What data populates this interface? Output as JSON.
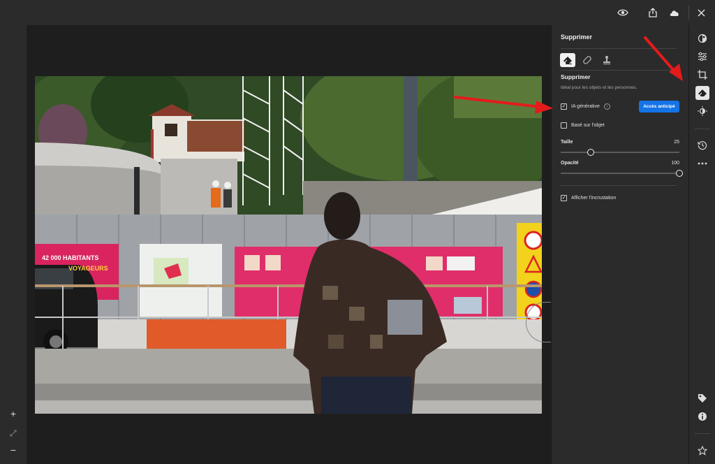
{
  "topbar": {
    "icons": [
      "eye-icon",
      "share-icon",
      "cloud-icon",
      "close-icon"
    ]
  },
  "left_toolbar": {
    "zoom_in_glyph": "+",
    "zoom_out_glyph": "−"
  },
  "panel": {
    "title": "Supprimer",
    "tools": [
      "eraser-icon",
      "bandage-icon",
      "stamp-icon"
    ],
    "section_title": "Supprimer",
    "section_desc": "Idéal pour les objets et les personnes.",
    "generative_ai": {
      "label": "IA générative",
      "checked": true
    },
    "early_access_label": "Accès anticipé",
    "object_based": {
      "label": "Basé sur l'objet",
      "checked": false
    },
    "size": {
      "label": "Taille",
      "value": "25",
      "fraction": 0.25
    },
    "opacity": {
      "label": "Opacité",
      "value": "100",
      "fraction": 1.0
    },
    "show_overlay": {
      "label": "Afficher l'incrustation",
      "checked": true
    }
  },
  "right_toolbar": {
    "icons": [
      "color-mix-icon",
      "sliders-icon",
      "crop-icon",
      "eraser-icon",
      "sun-icon",
      "history-icon",
      "more-icon",
      "tag-icon",
      "info-icon",
      "star-icon"
    ],
    "active": "eraser-icon"
  },
  "photo": {
    "banner_left_line1": "42 000 HABITANTS",
    "banner_left_line2": "VOYAGEURS"
  },
  "colors": {
    "accent": "#1473e6",
    "annotation_arrow": "#e31b1b",
    "panel_bg": "#2b2b2b",
    "canvas_bg": "#1e1e1e"
  }
}
